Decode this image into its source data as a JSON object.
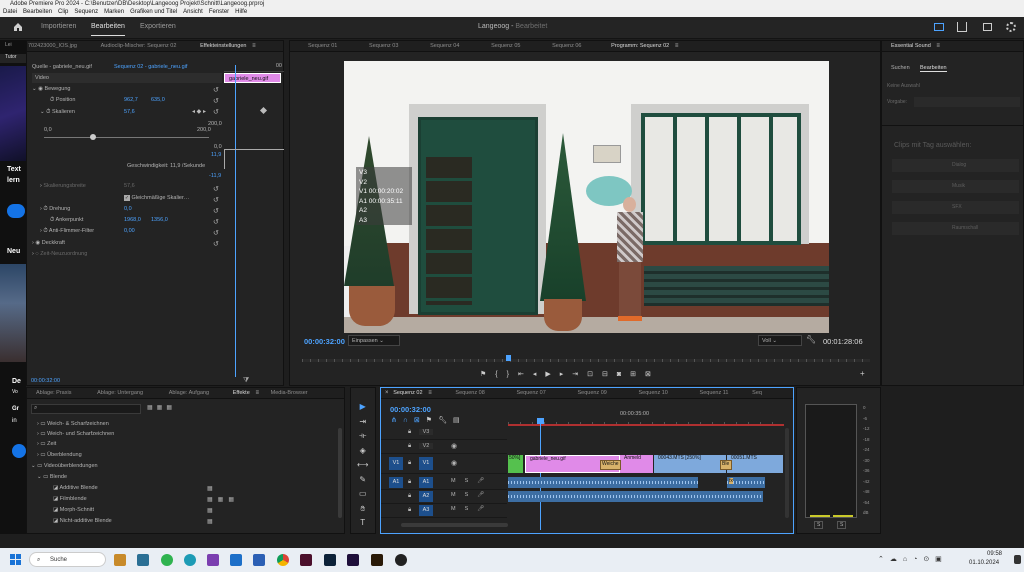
{
  "window": {
    "title": "Adobe Premiere Pro 2024 - C:\\Benutzer\\DB\\Desktop\\Langeoog Projekt\\Schnitt\\Langeoog.prproj"
  },
  "menu": [
    "Datei",
    "Bearbeiten",
    "Clip",
    "Sequenz",
    "Marken",
    "Grafiken und Titel",
    "Ansicht",
    "Fenster",
    "Hilfe"
  ],
  "appbar": {
    "tabs": [
      "Importieren",
      "Bearbeiten",
      "Exportieren"
    ],
    "project": "Langeoog",
    "state": "Bearbeitet"
  },
  "left_edge": {
    "labels": [
      "Lei",
      "Tutor",
      "Text",
      "lern",
      "Neu",
      "De",
      "Vo",
      "Gr",
      "in"
    ]
  },
  "effect_controls": {
    "tabs": [
      "Audioclip-Mischer: Sequenz 02",
      "Effekteinstellungen"
    ],
    "file_tab": "702423000_IOS.jpg",
    "source": "Quelle - gabriele_neu.gif",
    "sequence": "Sequenz 02 - gabriele_neu.gif",
    "clip_label": "gabriele_neu.gif",
    "time_ruler": "00",
    "section": "Video",
    "rows": {
      "bewegung": "Bewegung",
      "position": {
        "label": "Position",
        "x": "962,7",
        "y": "635,0"
      },
      "skalieren": {
        "label": "Skalieren",
        "value": "57,6"
      },
      "scale_min": "0,0",
      "scale_max": "200,0",
      "graph_top": "200,0",
      "graph_mid": "0,0",
      "graph_v1": "11,9",
      "graph_v2": "-11,9",
      "speed": "Geschwindigkeit: 11,9 /Sekunde",
      "breite": {
        "label": "Skalierungsbreite",
        "value": "57,6"
      },
      "gleich": "Gleichmäßige Skalier…",
      "drehung": {
        "label": "Drehung",
        "value": "0,0"
      },
      "anker": {
        "label": "Ankerpunkt",
        "x": "1968,0",
        "y": "1356,0"
      },
      "flimmer": {
        "label": "Anti-Flimmer-Filter",
        "value": "0,00"
      },
      "deckkraft": "Deckkraft",
      "zeit": "Zeit-Neuzuordnung"
    },
    "timecode": "00:00:32:00"
  },
  "effects": {
    "tabs": [
      "Ablage: Praxis",
      "Ablage: Untergang",
      "Ablage: Aufgang",
      "Effekte",
      "Media-Browser"
    ],
    "tree": [
      "Weich- & Scharfzeichnen",
      "Weich- und Scharfzeichnen",
      "Zeit",
      "Überblendung",
      "Videoüberblendungen",
      "Blende",
      "Additive Blende",
      "Filmblende",
      "Morph-Schnitt",
      "Nicht-additive Blende"
    ]
  },
  "sequences": [
    "Sequenz 01",
    "Sequenz 03",
    "Sequenz 04",
    "Sequenz 05",
    "Sequenz 06",
    "Programm: Sequenz 02"
  ],
  "program": {
    "overlay": [
      "V3",
      "V2",
      "V1 00:00:20:02",
      "A1 00:00:35:11",
      "A2",
      "A3"
    ],
    "timecode": "00:00:32:00",
    "fit": "Einpassen",
    "quality": "Voll",
    "duration": "00:01:28:06"
  },
  "timeline": {
    "tabs": [
      "Sequenz 02",
      "Sequenz 08",
      "Sequenz 07",
      "Sequenz 09",
      "Sequenz 10",
      "Sequenz 11",
      "Seq"
    ],
    "timecode": "00:00:32:00",
    "ruler": "00:00:35:00",
    "tracks": [
      "V3",
      "V2",
      "V1",
      "A1",
      "A2",
      "A3"
    ],
    "src_v": "V1",
    "src_a": "A1",
    "clips": {
      "c1": "50%]",
      "c2": "gabriele_neu.gif",
      "c3": "Anmeld",
      "c4": "00043.MTS [250%]",
      "c5": "00051.MTS",
      "tr1": "Weiche",
      "tr2": "Ble",
      "a_fx": "fx"
    }
  },
  "essential_sound": {
    "title": "Essential Sound",
    "tabs": [
      "Suchen",
      "Bearbeiten"
    ],
    "no_selection": "Keine Auswahl",
    "preset": "Vorgabe:",
    "hint": "Clips mit Tag auswählen:",
    "buttons": [
      "Dialog",
      "Musik",
      "SFX",
      "Raumschall"
    ]
  },
  "meter": {
    "scale": [
      "0",
      "-6",
      "-12",
      "-18",
      "-24",
      "-30",
      "-36",
      "-42",
      "-48",
      "-54",
      "dB"
    ],
    "s": [
      "S",
      "S"
    ]
  },
  "taskbar": {
    "search": "Suche",
    "time": "09:58",
    "date": "01.10.2024"
  },
  "colors": {
    "accent": "#4da3ff",
    "clip_pink": "#e08ae8",
    "clip_blue": "#7ea9dc",
    "clip_green": "#55c14e",
    "audio": "#3d6ea3"
  }
}
